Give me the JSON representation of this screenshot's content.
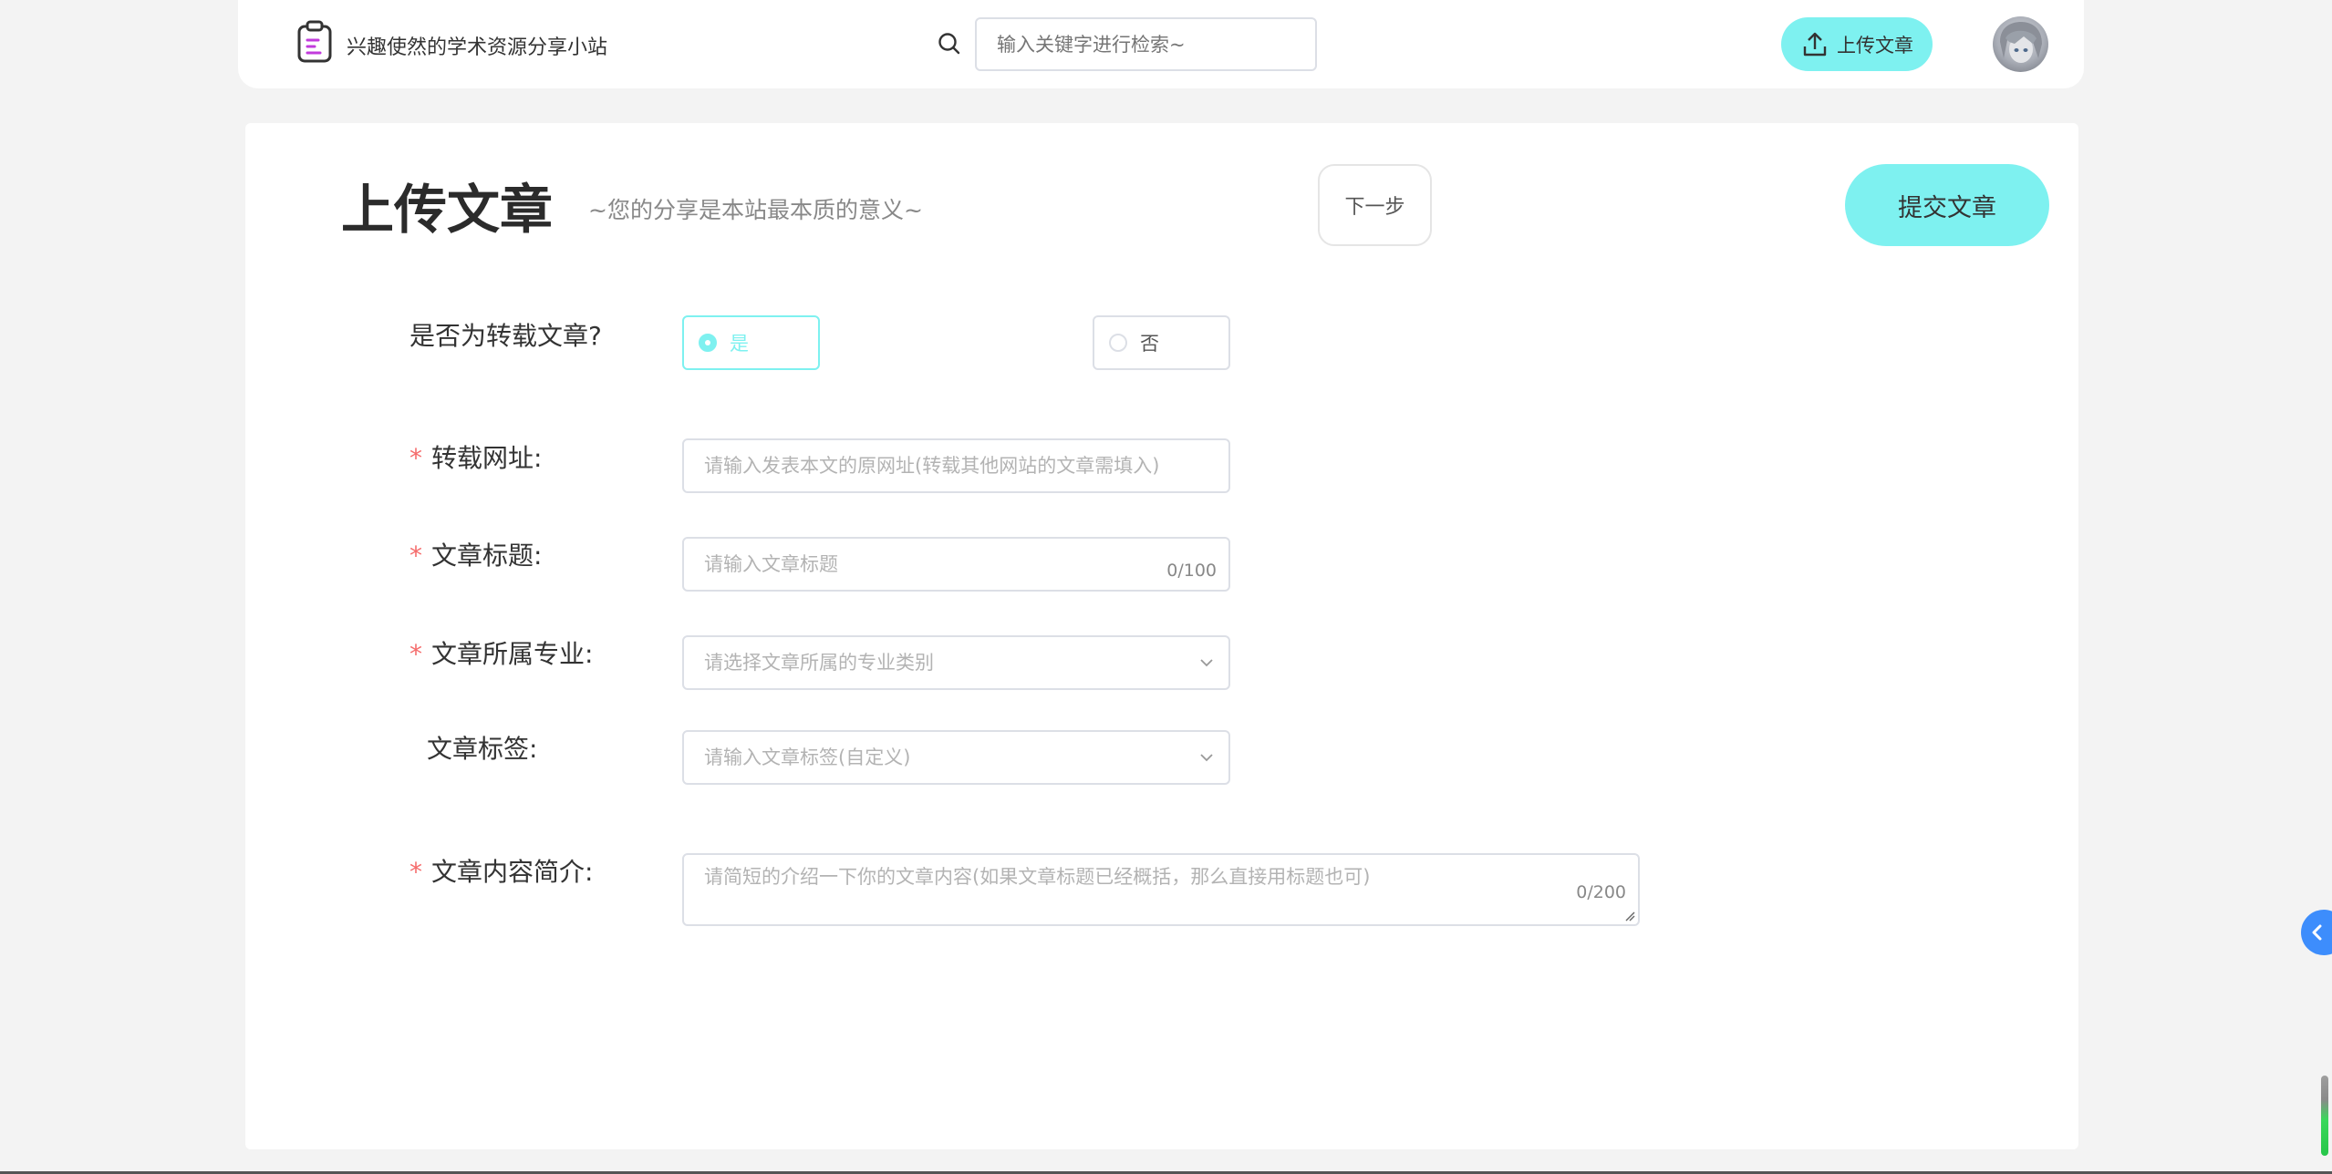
{
  "header": {
    "site_title": "兴趣使然的学术资源分享小站",
    "search_placeholder": "输入关键字进行检索~",
    "upload_label": "上传文章",
    "accent_color": "#7ef1f0"
  },
  "page": {
    "title": "上传文章",
    "subtitle": "~您的分享是本站最本质的意义~",
    "next_label": "下一步",
    "submit_label": "提交文章"
  },
  "form": {
    "repost": {
      "label": "是否为转载文章?",
      "options": [
        {
          "label": "是",
          "selected": true
        },
        {
          "label": "否",
          "selected": false
        }
      ]
    },
    "required_mark": "*",
    "source_url": {
      "label": "转载网址:",
      "placeholder": "请输入发表本文的原网址(转载其他网站的文章需填入)"
    },
    "article_title": {
      "label": "文章标题:",
      "placeholder": "请输入文章标题",
      "counter": "0/100"
    },
    "major": {
      "label": "文章所属专业:",
      "placeholder": "请选择文章所属的专业类别"
    },
    "tags": {
      "label": "文章标签:",
      "placeholder": "请输入文章标签(自定义)"
    },
    "summary": {
      "label": "文章内容简介:",
      "placeholder": "请简短的介绍一下你的文章内容(如果文章标题已经概括，那么直接用标题也可)",
      "counter": "0/200"
    }
  }
}
